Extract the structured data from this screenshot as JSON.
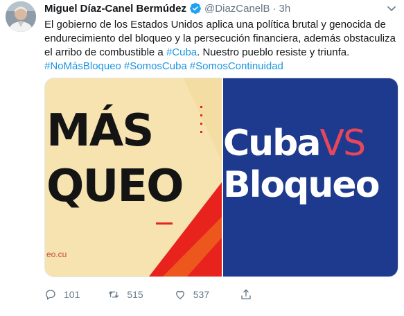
{
  "tweet": {
    "author_name": "Miguel Díaz-Canel Bermúdez",
    "author_handle": "@DiazCanelB",
    "separator": "·",
    "time": "3h",
    "text_line1": "El gobierno de los Estados Unidos aplica una política brutal y genocida de",
    "text_line2": "endurecimiento del bloqueo y la persecución financiera, además obstaculiza",
    "text_line3_pre": "el arribo de combustible a ",
    "text_line3_link": "#Cuba",
    "text_line3_post": ". Nuestro pueblo resiste y triunfa.",
    "hashtags": [
      "#NoMásBloqueo",
      "#SomosCuba",
      "#SomosContinuidad"
    ]
  },
  "media": {
    "left_image": {
      "line1": "MÁS",
      "line2": "QUEO",
      "site": "eo.cu"
    },
    "right_image": {
      "line1_a": "Cuba",
      "line1_b": "VS",
      "line2": "Bloqueo"
    }
  },
  "actions": {
    "reply_count": "101",
    "retweet_count": "515",
    "like_count": "537"
  },
  "icons": {
    "verified": "verified-badge-icon",
    "reply": "reply-icon",
    "retweet": "retweet-icon",
    "like": "heart-icon",
    "share": "share-icon",
    "menu": "chevron-down-icon"
  },
  "colors": {
    "link": "#1b95e0",
    "muted": "#657786",
    "left_bg": "#f6e3b0",
    "left_accent": "#e8231d",
    "right_bg": "#1e3a8e",
    "vs_color": "#e8475b"
  }
}
